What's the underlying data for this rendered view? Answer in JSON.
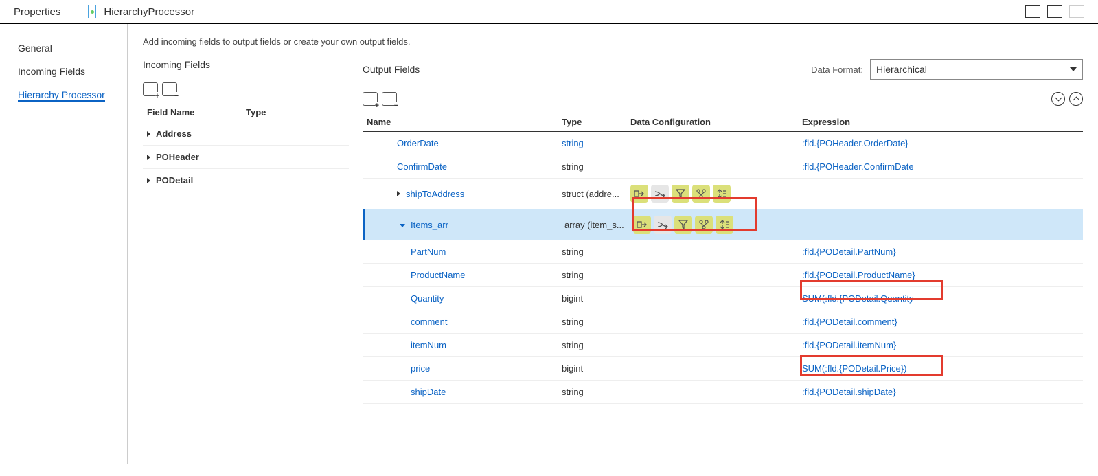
{
  "header": {
    "properties": "Properties",
    "processor": "HierarchyProcessor"
  },
  "tabs": {
    "general": "General",
    "incoming": "Incoming Fields",
    "hierarchy": "Hierarchy Processor"
  },
  "content": {
    "intro": "Add incoming fields to output fields or create your own output fields.",
    "incoming_title": "Incoming Fields",
    "output_title": "Output Fields",
    "data_format_label": "Data Format:",
    "data_format_value": "Hierarchical"
  },
  "inc_table": {
    "h1": "Field Name",
    "h2": "Type",
    "rows": [
      "Address",
      "POHeader",
      "PODetail"
    ]
  },
  "out_table": {
    "h1": "Name",
    "h2": "Type",
    "h3": "Data Configuration",
    "h4": "Expression",
    "rows": [
      {
        "name": "OrderDate",
        "type": "string",
        "expr": ":fld.{POHeader.OrderDate}",
        "class": "clip",
        "indent": 1
      },
      {
        "name": "ConfirmDate",
        "type": "string",
        "expr": ":fld.{POHeader.ConfirmDate",
        "indent": 1
      },
      {
        "name": "shipToAddress",
        "type": "struct (addre...",
        "expr": "",
        "indent": 1,
        "caret": "r",
        "cfg": true
      },
      {
        "name": "Items_arr",
        "type": "array (item_s...",
        "expr": "",
        "indent": 1,
        "caret": "d",
        "cfg": true,
        "selected": true
      },
      {
        "name": "PartNum",
        "type": "string",
        "expr": ":fld.{PODetail.PartNum}",
        "indent": 2
      },
      {
        "name": "ProductName",
        "type": "string",
        "expr": ":fld.{PODetail.ProductName}",
        "indent": 2
      },
      {
        "name": "Quantity",
        "type": "bigint",
        "expr": "SUM(:fld.{PODetail.Quantity",
        "indent": 2
      },
      {
        "name": "comment",
        "type": "string",
        "expr": ":fld.{PODetail.comment}",
        "indent": 2
      },
      {
        "name": "itemNum",
        "type": "string",
        "expr": ":fld.{PODetail.itemNum}",
        "indent": 2
      },
      {
        "name": "price",
        "type": "bigint",
        "expr": "SUM(:fld.{PODetail.Price})",
        "indent": 2
      },
      {
        "name": "shipDate",
        "type": "string",
        "expr": ":fld.{PODetail.shipDate}",
        "indent": 2
      }
    ]
  }
}
